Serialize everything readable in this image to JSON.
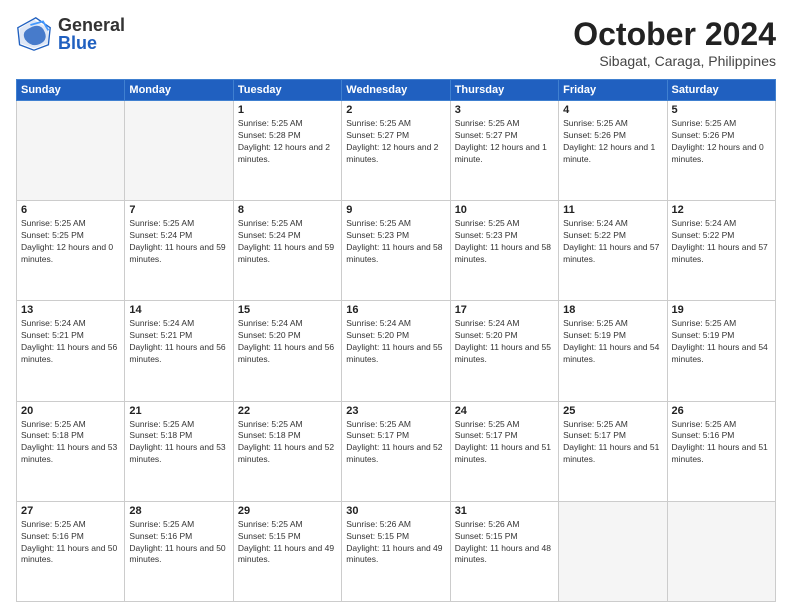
{
  "header": {
    "logo_text_general": "General",
    "logo_text_blue": "Blue",
    "title": "October 2024",
    "subtitle": "Sibagat, Caraga, Philippines"
  },
  "calendar": {
    "days_of_week": [
      "Sunday",
      "Monday",
      "Tuesday",
      "Wednesday",
      "Thursday",
      "Friday",
      "Saturday"
    ],
    "weeks": [
      [
        {
          "day": "",
          "empty": true
        },
        {
          "day": "",
          "empty": true
        },
        {
          "day": "1",
          "sunrise": "Sunrise: 5:25 AM",
          "sunset": "Sunset: 5:28 PM",
          "daylight": "Daylight: 12 hours and 2 minutes."
        },
        {
          "day": "2",
          "sunrise": "Sunrise: 5:25 AM",
          "sunset": "Sunset: 5:27 PM",
          "daylight": "Daylight: 12 hours and 2 minutes."
        },
        {
          "day": "3",
          "sunrise": "Sunrise: 5:25 AM",
          "sunset": "Sunset: 5:27 PM",
          "daylight": "Daylight: 12 hours and 1 minute."
        },
        {
          "day": "4",
          "sunrise": "Sunrise: 5:25 AM",
          "sunset": "Sunset: 5:26 PM",
          "daylight": "Daylight: 12 hours and 1 minute."
        },
        {
          "day": "5",
          "sunrise": "Sunrise: 5:25 AM",
          "sunset": "Sunset: 5:26 PM",
          "daylight": "Daylight: 12 hours and 0 minutes."
        }
      ],
      [
        {
          "day": "6",
          "sunrise": "Sunrise: 5:25 AM",
          "sunset": "Sunset: 5:25 PM",
          "daylight": "Daylight: 12 hours and 0 minutes."
        },
        {
          "day": "7",
          "sunrise": "Sunrise: 5:25 AM",
          "sunset": "Sunset: 5:24 PM",
          "daylight": "Daylight: 11 hours and 59 minutes."
        },
        {
          "day": "8",
          "sunrise": "Sunrise: 5:25 AM",
          "sunset": "Sunset: 5:24 PM",
          "daylight": "Daylight: 11 hours and 59 minutes."
        },
        {
          "day": "9",
          "sunrise": "Sunrise: 5:25 AM",
          "sunset": "Sunset: 5:23 PM",
          "daylight": "Daylight: 11 hours and 58 minutes."
        },
        {
          "day": "10",
          "sunrise": "Sunrise: 5:25 AM",
          "sunset": "Sunset: 5:23 PM",
          "daylight": "Daylight: 11 hours and 58 minutes."
        },
        {
          "day": "11",
          "sunrise": "Sunrise: 5:24 AM",
          "sunset": "Sunset: 5:22 PM",
          "daylight": "Daylight: 11 hours and 57 minutes."
        },
        {
          "day": "12",
          "sunrise": "Sunrise: 5:24 AM",
          "sunset": "Sunset: 5:22 PM",
          "daylight": "Daylight: 11 hours and 57 minutes."
        }
      ],
      [
        {
          "day": "13",
          "sunrise": "Sunrise: 5:24 AM",
          "sunset": "Sunset: 5:21 PM",
          "daylight": "Daylight: 11 hours and 56 minutes."
        },
        {
          "day": "14",
          "sunrise": "Sunrise: 5:24 AM",
          "sunset": "Sunset: 5:21 PM",
          "daylight": "Daylight: 11 hours and 56 minutes."
        },
        {
          "day": "15",
          "sunrise": "Sunrise: 5:24 AM",
          "sunset": "Sunset: 5:20 PM",
          "daylight": "Daylight: 11 hours and 56 minutes."
        },
        {
          "day": "16",
          "sunrise": "Sunrise: 5:24 AM",
          "sunset": "Sunset: 5:20 PM",
          "daylight": "Daylight: 11 hours and 55 minutes."
        },
        {
          "day": "17",
          "sunrise": "Sunrise: 5:24 AM",
          "sunset": "Sunset: 5:20 PM",
          "daylight": "Daylight: 11 hours and 55 minutes."
        },
        {
          "day": "18",
          "sunrise": "Sunrise: 5:25 AM",
          "sunset": "Sunset: 5:19 PM",
          "daylight": "Daylight: 11 hours and 54 minutes."
        },
        {
          "day": "19",
          "sunrise": "Sunrise: 5:25 AM",
          "sunset": "Sunset: 5:19 PM",
          "daylight": "Daylight: 11 hours and 54 minutes."
        }
      ],
      [
        {
          "day": "20",
          "sunrise": "Sunrise: 5:25 AM",
          "sunset": "Sunset: 5:18 PM",
          "daylight": "Daylight: 11 hours and 53 minutes."
        },
        {
          "day": "21",
          "sunrise": "Sunrise: 5:25 AM",
          "sunset": "Sunset: 5:18 PM",
          "daylight": "Daylight: 11 hours and 53 minutes."
        },
        {
          "day": "22",
          "sunrise": "Sunrise: 5:25 AM",
          "sunset": "Sunset: 5:18 PM",
          "daylight": "Daylight: 11 hours and 52 minutes."
        },
        {
          "day": "23",
          "sunrise": "Sunrise: 5:25 AM",
          "sunset": "Sunset: 5:17 PM",
          "daylight": "Daylight: 11 hours and 52 minutes."
        },
        {
          "day": "24",
          "sunrise": "Sunrise: 5:25 AM",
          "sunset": "Sunset: 5:17 PM",
          "daylight": "Daylight: 11 hours and 51 minutes."
        },
        {
          "day": "25",
          "sunrise": "Sunrise: 5:25 AM",
          "sunset": "Sunset: 5:17 PM",
          "daylight": "Daylight: 11 hours and 51 minutes."
        },
        {
          "day": "26",
          "sunrise": "Sunrise: 5:25 AM",
          "sunset": "Sunset: 5:16 PM",
          "daylight": "Daylight: 11 hours and 51 minutes."
        }
      ],
      [
        {
          "day": "27",
          "sunrise": "Sunrise: 5:25 AM",
          "sunset": "Sunset: 5:16 PM",
          "daylight": "Daylight: 11 hours and 50 minutes."
        },
        {
          "day": "28",
          "sunrise": "Sunrise: 5:25 AM",
          "sunset": "Sunset: 5:16 PM",
          "daylight": "Daylight: 11 hours and 50 minutes."
        },
        {
          "day": "29",
          "sunrise": "Sunrise: 5:25 AM",
          "sunset": "Sunset: 5:15 PM",
          "daylight": "Daylight: 11 hours and 49 minutes."
        },
        {
          "day": "30",
          "sunrise": "Sunrise: 5:26 AM",
          "sunset": "Sunset: 5:15 PM",
          "daylight": "Daylight: 11 hours and 49 minutes."
        },
        {
          "day": "31",
          "sunrise": "Sunrise: 5:26 AM",
          "sunset": "Sunset: 5:15 PM",
          "daylight": "Daylight: 11 hours and 48 minutes."
        },
        {
          "day": "",
          "empty": true
        },
        {
          "day": "",
          "empty": true
        }
      ]
    ]
  }
}
